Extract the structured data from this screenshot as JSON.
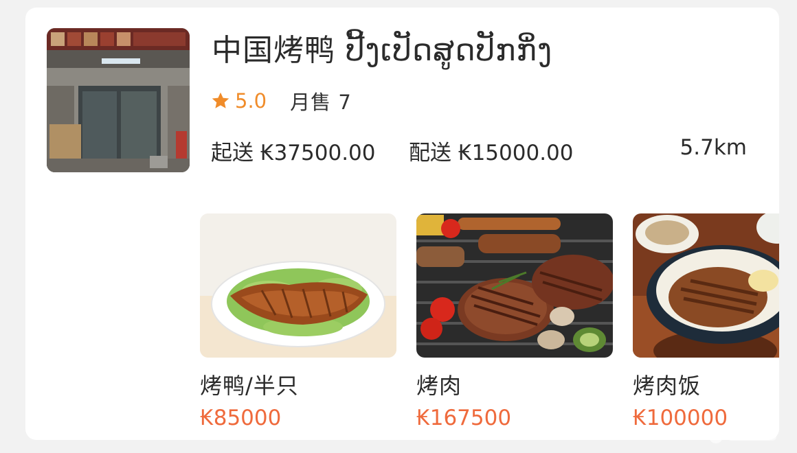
{
  "shop": {
    "name": "中国烤鸭 ປີ້ງເປັດສູດປັກກິ່ງ",
    "rating": "5.0",
    "monthly_sales": "月售 7",
    "min_order": "起送 ₭37500.00",
    "delivery_fee": "配送 ₭15000.00",
    "distance": "5.7km"
  },
  "icons": {
    "rating": "star-icon",
    "shop_photo": "storefront-photo"
  },
  "colors": {
    "rating": "#f08c2a",
    "price": "#ef6a3c",
    "text": "#2b2b2b"
  },
  "dishes": [
    {
      "name": "烤鸭/半只",
      "price": "₭85000"
    },
    {
      "name": "烤肉",
      "price": "₭167500"
    },
    {
      "name": "烤肉饭",
      "price": "₭100000"
    }
  ]
}
